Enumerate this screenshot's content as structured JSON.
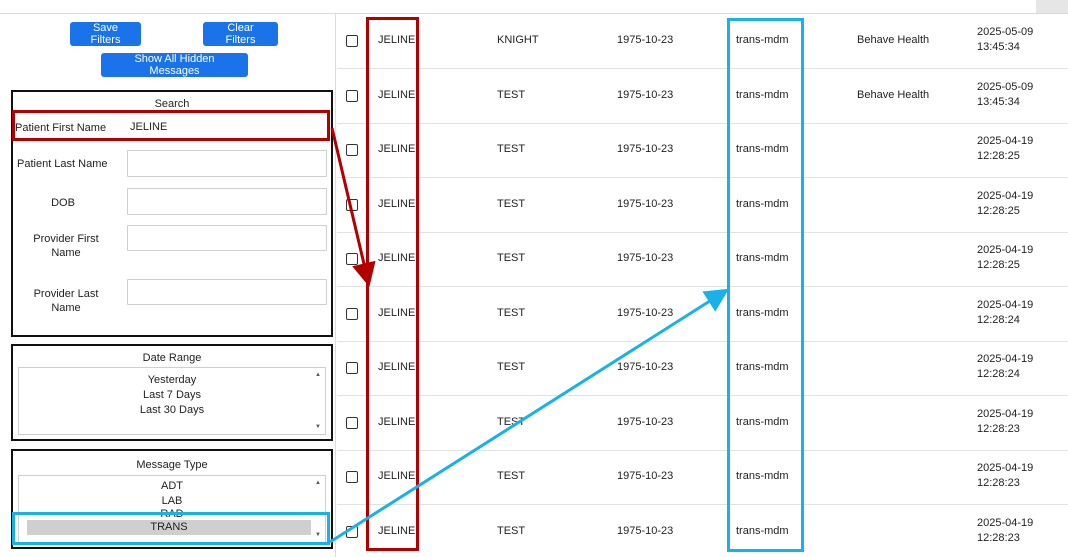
{
  "filters": {
    "save_label": "Save Filters",
    "clear_label": "Clear Filters",
    "show_hidden_label": "Show All Hidden Messages"
  },
  "search": {
    "title": "Search",
    "first_name_label": "Patient First Name",
    "first_name_value": "JELINE",
    "last_name_label": "Patient Last Name",
    "last_name_value": "",
    "dob_label": "DOB",
    "dob_value": "",
    "provider_first_label": "Provider First Name",
    "provider_first_value": "",
    "provider_last_label": "Provider Last Name",
    "provider_last_value": ""
  },
  "date_range": {
    "title": "Date Range",
    "options": [
      "Yesterday",
      "Last 7 Days",
      "Last 30 Days"
    ]
  },
  "message_type": {
    "title": "Message Type",
    "options": [
      "ADT",
      "LAB",
      "RAD",
      "TRANS"
    ],
    "selected": "TRANS"
  },
  "table": {
    "rows": [
      {
        "first": "JELINE",
        "last": "KNIGHT",
        "dob": "1975-10-23",
        "type": "trans-mdm",
        "facility": "Behave Health",
        "date": "2025-05-09",
        "time": "13:45:34"
      },
      {
        "first": "JELINE",
        "last": "TEST",
        "dob": "1975-10-23",
        "type": "trans-mdm",
        "facility": "Behave Health",
        "date": "2025-05-09",
        "time": "13:45:34"
      },
      {
        "first": "JELINE",
        "last": "TEST",
        "dob": "1975-10-23",
        "type": "trans-mdm",
        "facility": "",
        "date": "2025-04-19",
        "time": "12:28:25"
      },
      {
        "first": "JELINE",
        "last": "TEST",
        "dob": "1975-10-23",
        "type": "trans-mdm",
        "facility": "",
        "date": "2025-04-19",
        "time": "12:28:25"
      },
      {
        "first": "JELINE",
        "last": "TEST",
        "dob": "1975-10-23",
        "type": "trans-mdm",
        "facility": "",
        "date": "2025-04-19",
        "time": "12:28:25"
      },
      {
        "first": "JELINE",
        "last": "TEST",
        "dob": "1975-10-23",
        "type": "trans-mdm",
        "facility": "",
        "date": "2025-04-19",
        "time": "12:28:24"
      },
      {
        "first": "JELINE",
        "last": "TEST",
        "dob": "1975-10-23",
        "type": "trans-mdm",
        "facility": "",
        "date": "2025-04-19",
        "time": "12:28:24"
      },
      {
        "first": "JELINE",
        "last": "TEST",
        "dob": "1975-10-23",
        "type": "trans-mdm",
        "facility": "",
        "date": "2025-04-19",
        "time": "12:28:23"
      },
      {
        "first": "JELINE",
        "last": "TEST",
        "dob": "1975-10-23",
        "type": "trans-mdm",
        "facility": "",
        "date": "2025-04-19",
        "time": "12:28:23"
      },
      {
        "first": "JELINE",
        "last": "TEST",
        "dob": "1975-10-23",
        "type": "trans-mdm",
        "facility": "",
        "date": "2025-04-19",
        "time": "12:28:23"
      }
    ]
  },
  "colors": {
    "button_blue": "#1a73e8",
    "annotation_red": "#b00000",
    "annotation_blue": "#1ab0e8"
  }
}
